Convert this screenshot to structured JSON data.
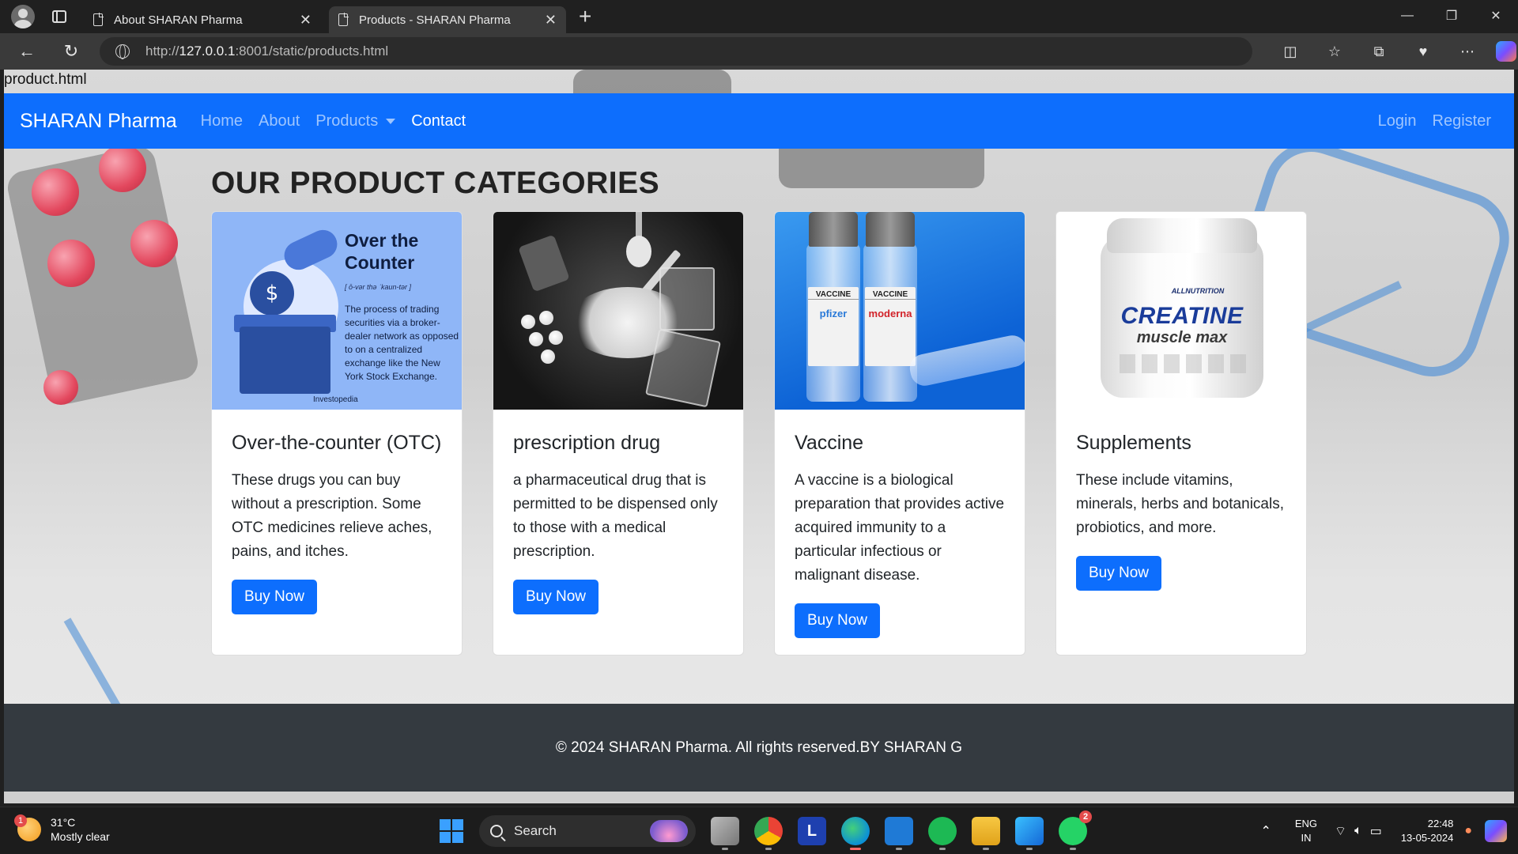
{
  "browser": {
    "tabs": [
      {
        "title": "About SHARAN Pharma",
        "active": false
      },
      {
        "title": "Products - SHARAN Pharma",
        "active": true
      }
    ],
    "url_prefix": "http://",
    "url_host": "127.0.0.1",
    "url_rest": ":8001/static/products.html"
  },
  "page": {
    "file_label": "product.html",
    "navbar": {
      "brand": "SHARAN Pharma",
      "links": [
        {
          "label": "Home"
        },
        {
          "label": "About"
        },
        {
          "label": "Products"
        },
        {
          "label": "Contact"
        }
      ],
      "right_links": [
        {
          "label": "Login"
        },
        {
          "label": "Register"
        }
      ],
      "bg_color": "#0d6efd"
    },
    "heading": "OUR PRODUCT CATEGORIES",
    "cards": [
      {
        "title": "Over-the-counter (OTC)",
        "text": "These drugs you can buy without a prescription. Some OTC medicines relieve aches, pains, and itches.",
        "button": "Buy Now",
        "image": {
          "title_line1": "Over the",
          "title_line2": "Counter",
          "pronunciation": "[ ō-vər thə ˈkaun-tər ]",
          "description": "The process of trading securities via a broker-dealer network as opposed to on a centralized exchange like the New York Stock Exchange.",
          "brand": "Investopedia",
          "dollar": "$"
        }
      },
      {
        "title": "prescription drug",
        "text": "a pharmaceutical drug that is permitted to be dispensed only to those with a medical prescription.",
        "button": "Buy Now"
      },
      {
        "title": "Vaccine",
        "text": "A vaccine is a biological preparation that provides active acquired immunity to a particular infectious or malignant disease.",
        "button": "Buy Now",
        "image": {
          "vial1_top": "VACCINE",
          "vial1_brand": "pfizer",
          "vial2_top": "VACCINE",
          "vial2_brand": "moderna"
        }
      },
      {
        "title": "Supplements",
        "text": "These include vitamins, minerals, herbs and botanicals, probiotics, and more.",
        "button": "Buy Now",
        "image": {
          "brand": "ALLNUTRITION",
          "product": "CREATINE",
          "subproduct": "muscle max"
        }
      }
    ],
    "footer": "© 2024 SHARAN Pharma. All rights reserved.BY SHARAN G"
  },
  "taskbar": {
    "weather_temp": "31°C",
    "weather_desc": "Mostly clear",
    "weather_badge": "1",
    "search_label": "Search",
    "whatsapp_badge": "2",
    "lang_line1": "ENG",
    "lang_line2": "IN",
    "time": "22:48",
    "date": "13-05-2024"
  }
}
